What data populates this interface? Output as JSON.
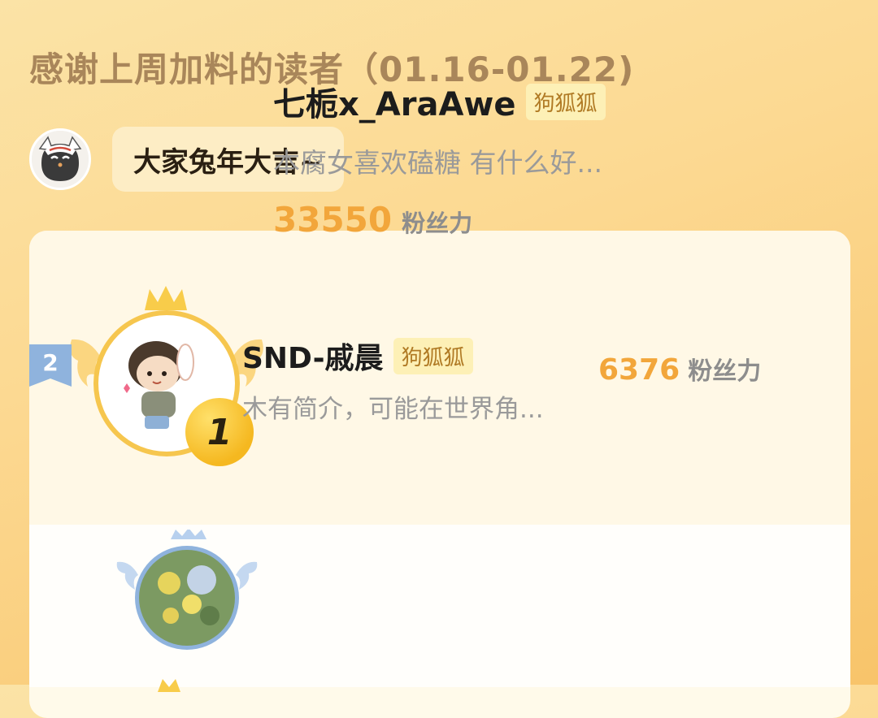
{
  "header": {
    "title": "感谢上周加料的读者（01.16-01.22)"
  },
  "greeting": {
    "text": "大家兔年大吉~"
  },
  "leaderboard": {
    "first": {
      "rank": "1",
      "username": "七栀x_AraAwe",
      "tag": "狗狐狐",
      "bio": "本腐女喜欢磕糖 有什么好...",
      "score": "33550",
      "score_unit": "粉丝力"
    },
    "second": {
      "rank": "2",
      "username": "SND-戚晨",
      "tag": "狗狐狐",
      "bio": "木有简介，可能在世界角...",
      "score": "6376",
      "score_unit": "粉丝力"
    }
  },
  "colors": {
    "accent_orange": "#f2a63b",
    "tag_bg": "#fdf0b6",
    "gold": "#f5b820",
    "silver": "#8fb3dd"
  }
}
